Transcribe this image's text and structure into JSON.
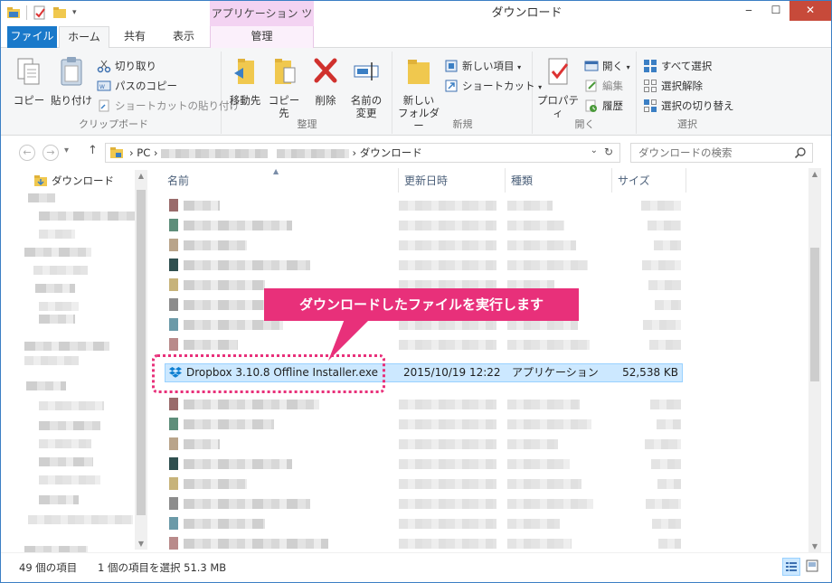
{
  "window": {
    "title": "ダウンロード",
    "context_tab_title": "アプリケーション ツール",
    "minimize": "‒",
    "maximize": "☐",
    "close": "✕"
  },
  "tabs": [
    {
      "label": "ファイル"
    },
    {
      "label": "ホーム"
    },
    {
      "label": "共有"
    },
    {
      "label": "表示"
    },
    {
      "label": "管理"
    }
  ],
  "ribbon": {
    "clipboard": {
      "label": "クリップボード",
      "copy": "コピー",
      "paste": "貼り付け",
      "cut": "切り取り",
      "copy_path": "パスのコピー",
      "paste_shortcut": "ショートカットの貼り付け"
    },
    "organize": {
      "label": "整理",
      "move_to": "移動先",
      "copy_to": "コピー先",
      "delete": "削除",
      "rename_line1": "名前の",
      "rename_line2": "変更"
    },
    "new": {
      "label": "新規",
      "new_folder_line1": "新しい",
      "new_folder_line2": "フォルダー",
      "new_item": "新しい項目",
      "shortcut": "ショートカット"
    },
    "open": {
      "label": "開く",
      "properties": "プロパティ",
      "open": "開く",
      "edit": "編集",
      "history": "履歴"
    },
    "select": {
      "label": "選択",
      "select_all": "すべて選択",
      "select_none": "選択解除",
      "invert": "選択の切り替え"
    }
  },
  "address": {
    "pc": "PC",
    "current": "ダウンロード",
    "sep": "›"
  },
  "search": {
    "placeholder": "ダウンロードの検索"
  },
  "nav": {
    "current_folder": "ダウンロード"
  },
  "columns": {
    "name": "名前",
    "modified": "更新日時",
    "type": "種類",
    "size": "サイズ"
  },
  "selected_file": {
    "name": "Dropbox 3.10.8 Offline Installer.exe",
    "modified": "2015/10/19 12:22",
    "type": "アプリケーション",
    "size": "52,538 KB"
  },
  "callout": {
    "text": "ダウンロードしたファイルを実行します"
  },
  "status": {
    "item_count": "49 個の項目",
    "selection": "1 個の項目を選択  51.3 MB"
  },
  "colors": {
    "accent": "#1979ca",
    "callout": "#e8307a",
    "selection": "#cce8ff"
  }
}
